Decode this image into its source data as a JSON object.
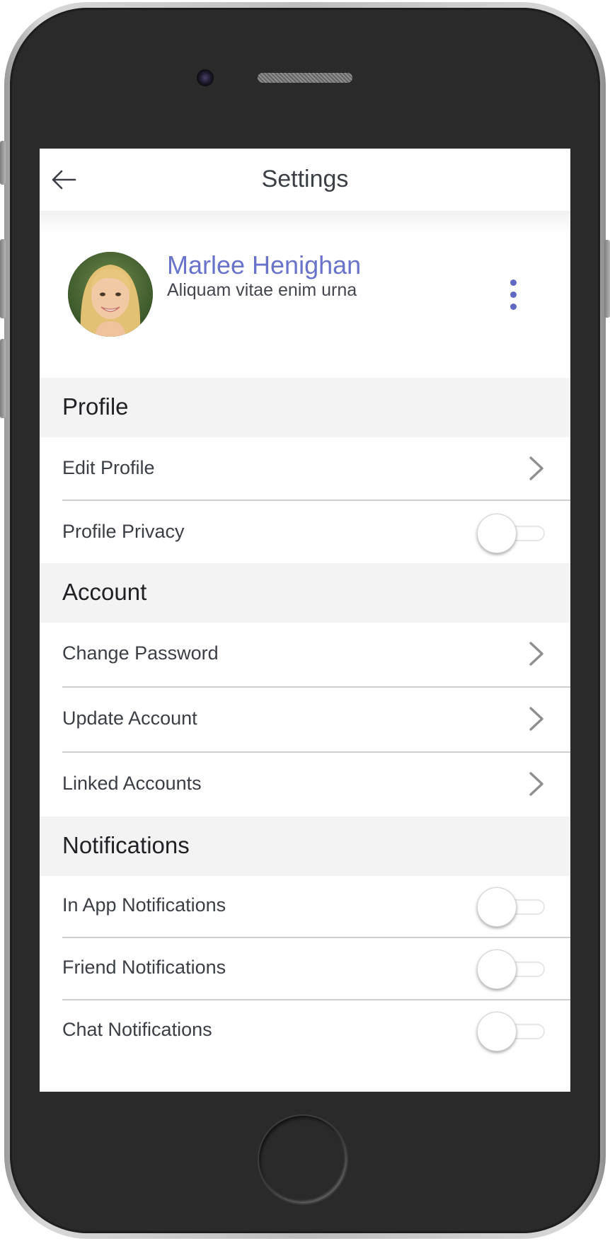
{
  "header": {
    "title": "Settings",
    "back_icon": "arrow-left-icon"
  },
  "profile": {
    "name": "Marlee Henighan",
    "subtitle": "Aliquam vitae enim urna",
    "more_icon": "vertical-ellipsis-icon",
    "accent_color": "#6873c9"
  },
  "sections": {
    "profile": {
      "label": "Profile",
      "items": {
        "edit_profile": {
          "label": "Edit Profile",
          "control": "chevron-right-icon"
        },
        "profile_privacy": {
          "label": "Profile Privacy",
          "control": "toggle",
          "enabled": false
        }
      }
    },
    "account": {
      "label": "Account",
      "items": {
        "change_password": {
          "label": "Change Password",
          "control": "chevron-right-icon"
        },
        "update_account": {
          "label": "Update Account",
          "control": "chevron-right-icon"
        },
        "linked_accounts": {
          "label": "Linked Accounts",
          "control": "chevron-right-icon"
        }
      }
    },
    "notifications": {
      "label": "Notifications",
      "items": {
        "in_app": {
          "label": "In App Notifications",
          "control": "toggle",
          "enabled": false
        },
        "friend": {
          "label": "Friend Notifications",
          "control": "toggle",
          "enabled": false
        },
        "chat": {
          "label": "Chat Notifications",
          "control": "toggle",
          "enabled": false
        }
      }
    }
  },
  "colors": {
    "section_background": "#f3f3f3",
    "text_primary": "#3b3f45",
    "divider": "#cfcfcf"
  }
}
